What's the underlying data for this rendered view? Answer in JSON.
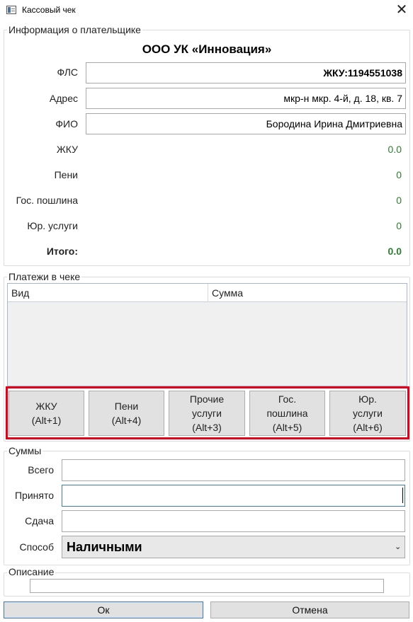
{
  "window": {
    "title": "Кассовый чек",
    "close_symbol": "✕"
  },
  "payer": {
    "legend": "Информация о плательщике",
    "org_name": "ООО УК «Инновация»",
    "fls_label": "ФЛС",
    "fls_value": "ЖКУ:1194551038",
    "address_label": "Адрес",
    "address_value": "мкр-н мкр. 4-й, д. 18, кв. 7",
    "fio_label": "ФИО",
    "fio_value": "Бородина Ирина Дмитриевна",
    "zhku_label": "ЖКУ",
    "zhku_value": "0.0",
    "peni_label": "Пени",
    "peni_value": "0",
    "gos_label": "Гос. пошлина",
    "gos_value": "0",
    "yur_label": "Юр. услуги",
    "yur_value": "0",
    "total_label": "Итого:",
    "total_value": "0.0",
    "accent_color": "#2e7d32"
  },
  "payments": {
    "legend": "Платежи в чеке",
    "columns": [
      "Вид",
      "Сумма"
    ],
    "buttons": [
      {
        "line1": "ЖКУ",
        "line2": "(Alt+1)",
        "line3": ""
      },
      {
        "line1": "Пени",
        "line2": "(Alt+4)",
        "line3": ""
      },
      {
        "line1": "Прочие",
        "line2": "услуги",
        "line3": "(Alt+3)"
      },
      {
        "line1": "Гос.",
        "line2": "пошлина",
        "line3": "(Alt+5)"
      },
      {
        "line1": "Юр.",
        "line2": "услуги",
        "line3": "(Alt+6)"
      }
    ],
    "highlight_color": "#e3001b"
  },
  "sums": {
    "legend": "Суммы",
    "total_label": "Всего",
    "total_value": "",
    "accepted_label": "Принято",
    "accepted_value": "",
    "change_label": "Сдача",
    "change_value": "",
    "method_label": "Способ",
    "method_value": "Наличными",
    "chevron_icon": "chevron-down-icon"
  },
  "description": {
    "legend": "Описание",
    "value": ""
  },
  "footer": {
    "ok_label": "Ок",
    "cancel_label": "Отмена"
  }
}
